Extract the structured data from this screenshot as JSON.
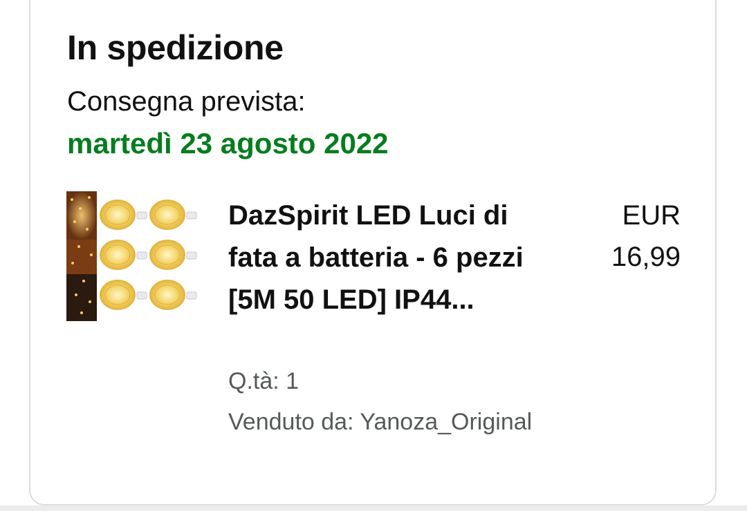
{
  "shipment": {
    "status": "In spedizione",
    "delivery_label": "Consegna prevista:",
    "delivery_date": "martedì 23 agosto 2022",
    "status_color": "#067d1f"
  },
  "item": {
    "image_icon": "fairy-lights-product-image",
    "title": "DazSpirit LED Luci di fata a batteria - 6 pezzi [5M 50 LED] IP44...",
    "price_currency": "EUR",
    "price_value": "16,99",
    "quantity": "Q.tà: 1",
    "seller": "Venduto da: Yanoza_Original"
  }
}
